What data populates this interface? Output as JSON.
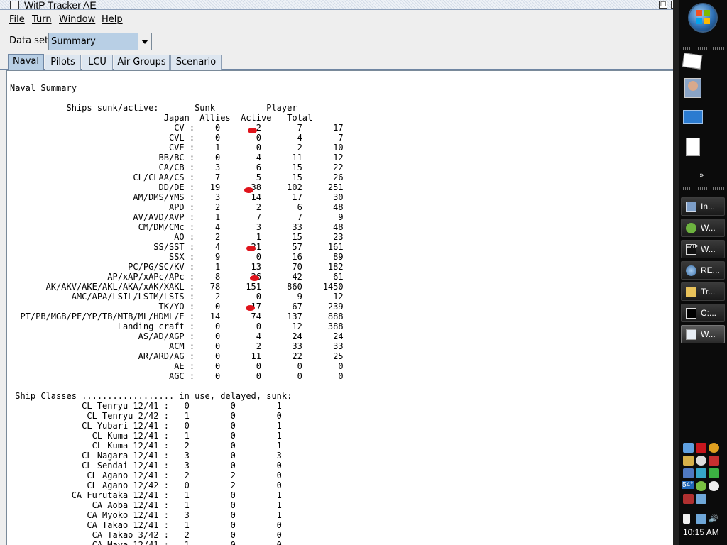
{
  "window": {
    "title": "WitP Tracker AE",
    "maximize_glyph": "□",
    "close_glyph": "✕"
  },
  "menu": {
    "items": [
      "File",
      "Turn",
      "Window",
      "Help"
    ]
  },
  "dataset": {
    "label": "Data set:",
    "value": "Summary"
  },
  "tabs": [
    "Naval",
    "Pilots",
    "LCU",
    "Air Groups",
    "Scenario"
  ],
  "report": {
    "title": "Naval Summary",
    "header_line1": "           Ships sunk/active:       Sunk          Player",
    "header_line2": "                              Japan  Allies  Active   Total",
    "ship_rows": [
      {
        "type": "CV",
        "japan": "0",
        "allies": "2",
        "active": "7",
        "total": "17"
      },
      {
        "type": "CVL",
        "japan": "0",
        "allies": "0",
        "active": "4",
        "total": "7"
      },
      {
        "type": "CVE",
        "japan": "1",
        "allies": "0",
        "active": "2",
        "total": "10"
      },
      {
        "type": "BB/BC",
        "japan": "0",
        "allies": "4",
        "active": "11",
        "total": "12"
      },
      {
        "type": "CA/CB",
        "japan": "3",
        "allies": "6",
        "active": "15",
        "total": "22"
      },
      {
        "type": "CL/CLAA/CS",
        "japan": "7",
        "allies": "5",
        "active": "15",
        "total": "26"
      },
      {
        "type": "DD/DE",
        "japan": "19",
        "allies": "38",
        "active": "102",
        "total": "251"
      },
      {
        "type": "AM/DMS/YMS",
        "japan": "3",
        "allies": "14",
        "active": "17",
        "total": "30"
      },
      {
        "type": "APD",
        "japan": "2",
        "allies": "2",
        "active": "6",
        "total": "48"
      },
      {
        "type": "AV/AVD/AVP",
        "japan": "1",
        "allies": "7",
        "active": "7",
        "total": "9"
      },
      {
        "type": "CM/DM/CMc",
        "japan": "4",
        "allies": "3",
        "active": "33",
        "total": "48"
      },
      {
        "type": "AO",
        "japan": "2",
        "allies": "1",
        "active": "15",
        "total": "23"
      },
      {
        "type": "SS/SST",
        "japan": "4",
        "allies": "21",
        "active": "57",
        "total": "161"
      },
      {
        "type": "SSX",
        "japan": "9",
        "allies": "0",
        "active": "16",
        "total": "89"
      },
      {
        "type": "PC/PG/SC/KV",
        "japan": "1",
        "allies": "13",
        "active": "70",
        "total": "182"
      },
      {
        "type": "AP/xAP/xAPc/APc",
        "japan": "8",
        "allies": "36",
        "active": "42",
        "total": "61"
      },
      {
        "type": "AK/AKV/AKE/AKL/AKA/xAK/XAKL",
        "japan": "78",
        "allies": "151",
        "active": "860",
        "total": "1450"
      },
      {
        "type": "AMC/APA/LSIL/LSIM/LSIS",
        "japan": "2",
        "allies": "0",
        "active": "9",
        "total": "12"
      },
      {
        "type": "TK/YO",
        "japan": "0",
        "allies": "17",
        "active": "67",
        "total": "239"
      },
      {
        "type": "PT/PB/MGB/PF/YP/TB/MTB/ML/HDML/E",
        "japan": "14",
        "allies": "74",
        "active": "137",
        "total": "888"
      },
      {
        "type": "Landing craft",
        "japan": "0",
        "allies": "0",
        "active": "12",
        "total": "388"
      },
      {
        "type": "AS/AD/AGP",
        "japan": "0",
        "allies": "4",
        "active": "24",
        "total": "24"
      },
      {
        "type": "ACM",
        "japan": "0",
        "allies": "2",
        "active": "33",
        "total": "33"
      },
      {
        "type": "AR/ARD/AG",
        "japan": "0",
        "allies": "11",
        "active": "22",
        "total": "25"
      },
      {
        "type": "AE",
        "japan": "0",
        "allies": "0",
        "active": "0",
        "total": "0"
      },
      {
        "type": "AGC",
        "japan": "0",
        "allies": "0",
        "active": "0",
        "total": "0"
      }
    ],
    "classes_header": " Ship Classes .................. in use, delayed, sunk:",
    "class_rows": [
      {
        "name": "CL Tenryu 12/41",
        "in_use": "0",
        "delayed": "0",
        "sunk": "1"
      },
      {
        "name": "CL Tenryu 2/42",
        "in_use": "1",
        "delayed": "0",
        "sunk": "0"
      },
      {
        "name": "CL Yubari 12/41",
        "in_use": "0",
        "delayed": "0",
        "sunk": "1"
      },
      {
        "name": "CL Kuma 12/41",
        "in_use": "1",
        "delayed": "0",
        "sunk": "1"
      },
      {
        "name": "CL Kuma 12/41",
        "in_use": "2",
        "delayed": "0",
        "sunk": "1"
      },
      {
        "name": "CL Nagara 12/41",
        "in_use": "3",
        "delayed": "0",
        "sunk": "3"
      },
      {
        "name": "CL Sendai 12/41",
        "in_use": "3",
        "delayed": "0",
        "sunk": "0"
      },
      {
        "name": "CL Agano 12/41",
        "in_use": "2",
        "delayed": "2",
        "sunk": "0"
      },
      {
        "name": "CL Agano 12/42",
        "in_use": "0",
        "delayed": "2",
        "sunk": "0"
      },
      {
        "name": "CA Furutaka 12/41",
        "in_use": "1",
        "delayed": "0",
        "sunk": "1"
      },
      {
        "name": "CA Aoba 12/41",
        "in_use": "1",
        "delayed": "0",
        "sunk": "1"
      },
      {
        "name": "CA Myoko 12/41",
        "in_use": "3",
        "delayed": "0",
        "sunk": "1"
      },
      {
        "name": "CA Takao 12/41",
        "in_use": "1",
        "delayed": "0",
        "sunk": "0"
      },
      {
        "name": "CA Takao 3/42",
        "in_use": "2",
        "delayed": "0",
        "sunk": "0"
      },
      {
        "name": "CA Maya 12/41",
        "in_use": "1",
        "delayed": "0",
        "sunk": "0"
      }
    ]
  },
  "taskbar": {
    "buttons": [
      {
        "label": "In...",
        "icon": "network-icon"
      },
      {
        "label": "W...",
        "icon": "messenger-icon"
      },
      {
        "label": "W...",
        "icon": "witp-ae-icon"
      },
      {
        "label": "RE...",
        "icon": "globe-icon"
      },
      {
        "label": "Tr...",
        "icon": "folder-icon"
      },
      {
        "label": "C:...",
        "icon": "console-icon"
      },
      {
        "label": "W...",
        "icon": "java-icon"
      }
    ],
    "temperature": "54°",
    "clock": "10:15 AM"
  },
  "colors": {
    "accent": "#b8cfe5",
    "mark": "#e0141c"
  }
}
